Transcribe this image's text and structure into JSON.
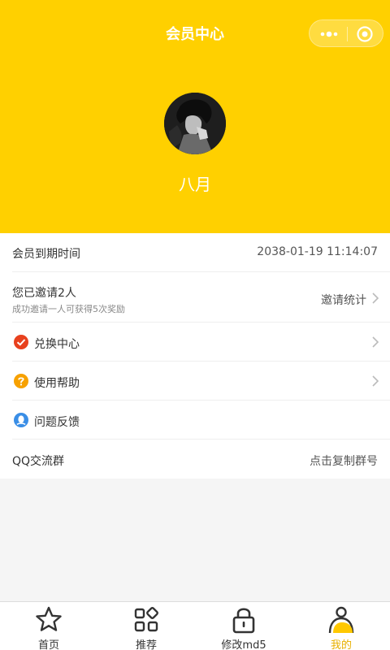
{
  "header": {
    "title": "会员中心",
    "bg_color": "#FFD000",
    "capsule": {
      "more_icon": "more-icon",
      "close_icon": "target-icon"
    }
  },
  "profile": {
    "avatar": "avatar-photo",
    "name": "八月"
  },
  "list": {
    "expiry": {
      "label": "会员到期时间",
      "value": "2038-01-19 11:14:07"
    },
    "invite": {
      "label": "您已邀请2人",
      "sub": "成功邀请一人可获得5次奖励",
      "action": "邀请统计"
    },
    "redeem": {
      "label": "兑换中心",
      "icon_color": "#E8411E"
    },
    "help": {
      "label": "使用帮助",
      "icon_color": "#F7A100"
    },
    "feedback": {
      "label": "问题反馈",
      "icon_color": "#3A8EE6"
    },
    "qq": {
      "label": "QQ交流群",
      "action": "点击复制群号"
    }
  },
  "tabbar": {
    "items": [
      {
        "label": "首页",
        "icon": "star-icon"
      },
      {
        "label": "推荐",
        "icon": "grid-icon"
      },
      {
        "label": "修改md5",
        "icon": "lock-icon"
      },
      {
        "label": "我的",
        "icon": "user-icon",
        "active": true
      }
    ],
    "active_color": "#E8B000"
  }
}
